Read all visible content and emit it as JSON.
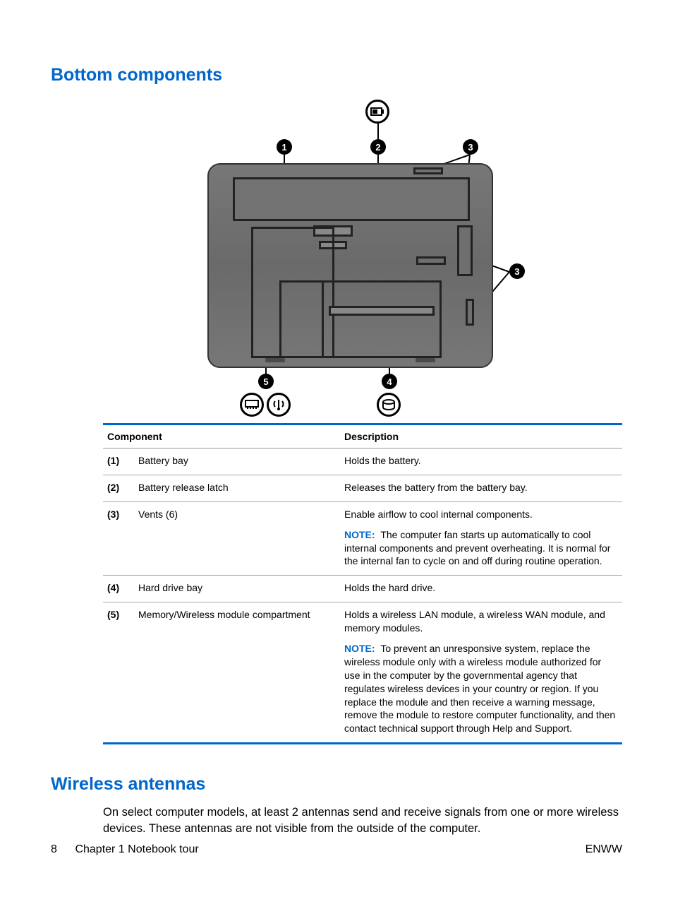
{
  "headings": {
    "bottom": "Bottom components",
    "wireless": "Wireless antennas"
  },
  "table": {
    "head": {
      "component": "Component",
      "description": "Description"
    },
    "note_label": "NOTE:",
    "rows": [
      {
        "idx": "(1)",
        "name": "Battery bay",
        "desc": "Holds the battery."
      },
      {
        "idx": "(2)",
        "name": "Battery release latch",
        "desc": "Releases the battery from the battery bay."
      },
      {
        "idx": "(3)",
        "name": "Vents (6)",
        "desc": "Enable airflow to cool internal components.",
        "note": "The computer fan starts up automatically to cool internal components and prevent overheating. It is normal for the internal fan to cycle on and off during routine operation."
      },
      {
        "idx": "(4)",
        "name": "Hard drive bay",
        "desc": "Holds the hard drive."
      },
      {
        "idx": "(5)",
        "name": "Memory/Wireless module compartment",
        "desc": "Holds a wireless LAN module, a wireless WAN module, and memory modules.",
        "note": "To prevent an unresponsive system, replace the wireless module only with a wireless module authorized for use in the computer by the governmental agency that regulates wireless devices in your country or region. If you replace the module and then receive a warning message, remove the module to restore computer functionality, and then contact technical support through Help and Support."
      }
    ]
  },
  "callouts": {
    "c1": "1",
    "c2": "2",
    "c3": "3",
    "c4": "4",
    "c5": "5"
  },
  "wireless_body": "On select computer models, at least 2 antennas send and receive signals from one or more wireless devices. These antennas are not visible from the outside of the computer.",
  "footer": {
    "page": "8",
    "chapter": "Chapter 1   Notebook tour",
    "right": "ENWW"
  }
}
